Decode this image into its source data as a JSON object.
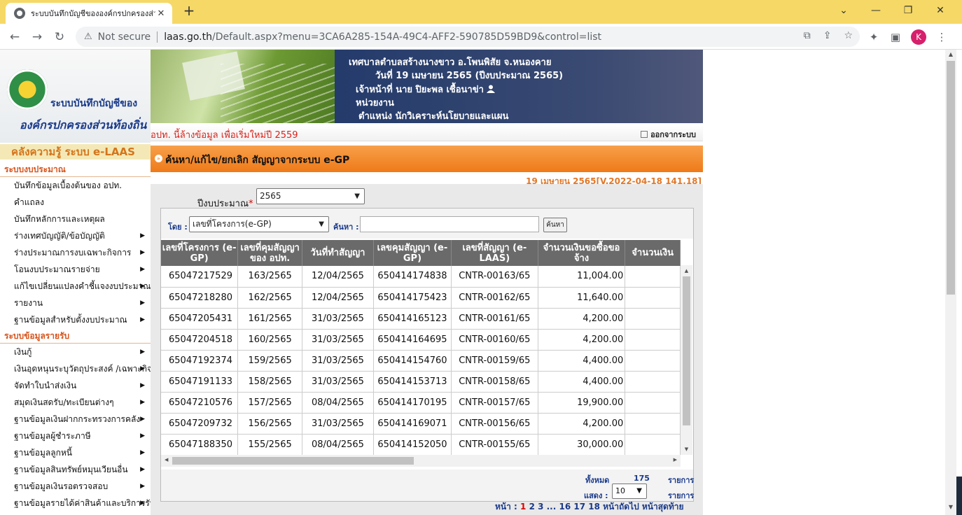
{
  "browser": {
    "tab_title": "ระบบบันทึกบัญชีขององค์กรปกครองส่วนท้องถิ่น",
    "address": {
      "not_secure": "Not secure",
      "host": "laas.go.th",
      "path": "/Default.aspx?menu=3CA6A285-154A-49C4-AFF2-590785D59BD9&control=list"
    },
    "profile_initial": "K"
  },
  "logo": {
    "line1": "ระบบบันทึกบัญชีของ",
    "line2": "องค์กรปกครองส่วนท้องถิ่น"
  },
  "knowledge_banner": "คลังความรู้ ระบบ e-LAAS",
  "menu": {
    "budget_section": "ระบบงบประมาณ",
    "budget_items": [
      {
        "label": "บันทึกข้อมูลเบื้องต้นของ อปท.",
        "sub": false
      },
      {
        "label": "คำแถลง",
        "sub": false
      },
      {
        "label": "บันทึกหลักการและเหตุผล",
        "sub": false
      },
      {
        "label": "ร่างเทศบัญญัติ/ข้อบัญญัติ",
        "sub": true
      },
      {
        "label": "ร่างประมาณการงบเฉพาะกิจการ",
        "sub": true
      },
      {
        "label": "โอนงบประมาณรายจ่าย",
        "sub": true
      },
      {
        "label": "แก้ไขเปลี่ยนแปลงคำชี้แจงงบประมาณ",
        "sub": true
      },
      {
        "label": "รายงาน",
        "sub": true
      },
      {
        "label": "ฐานข้อมูลสำหรับตั้งงบประมาณ",
        "sub": true
      }
    ],
    "revenue_section": "ระบบข้อมูลรายรับ",
    "revenue_items": [
      {
        "label": "เงินกู้",
        "sub": true
      },
      {
        "label": "เงินอุดหนุนระบุวัตถุประสงค์ /เฉพาะกิจ",
        "sub": true
      },
      {
        "label": "จัดทำใบนำส่งเงิน",
        "sub": true
      },
      {
        "label": "สมุดเงินสดรับ/ทะเบียนต่างๆ",
        "sub": true
      },
      {
        "label": "ฐานข้อมูลเงินฝากกระทรวงการคลัง",
        "sub": true
      },
      {
        "label": "ฐานข้อมูลผู้ชำระภาษี",
        "sub": true
      },
      {
        "label": "ฐานข้อมูลลูกหนี้",
        "sub": true
      },
      {
        "label": "ฐานข้อมูลสินทรัพย์หมุนเวียนอื่น",
        "sub": true
      },
      {
        "label": "ฐานข้อมูลเงินรอตรวจสอบ",
        "sub": true
      },
      {
        "label": "ฐานข้อมูลรายได้ค่าสินค้าและบริการรับ",
        "sub": true
      }
    ]
  },
  "header": {
    "org": "เทศบาลตำบลสร้างนางขาว อ.โพนพิสัย จ.หนองคาย",
    "date_line": "วันที่ 19 เมษายน 2565  (ปีงบประมาณ 2565)",
    "officer": "เจ้าหน้าที่ นาย ปิยะพล เชื้อนาข่า",
    "unit": "หน่วยงาน",
    "position": "ตำแหน่ง นักวิเคราะห์นโยบายและแผน",
    "notice": "อปท. นี้ล้างข้อมูล เพื่อเริ่มใหม่ปี 2559",
    "logout": "ออกจากระบบ"
  },
  "page": {
    "title": "ค้นหา/แก้ไข/ยกเลิก สัญญาจากระบบ e-GP",
    "version": "19 เมษายน 2565[V.2022-04-18 141.18]",
    "fiscal_year_label": "ปีงบประมาณ",
    "fiscal_year_value": "2565",
    "search": {
      "by_label": "โดย :",
      "by_value": "เลขที่โครงการ(e-GP)",
      "find_label": "ค้นหา :",
      "find_value": "",
      "button": "ค้นหา"
    }
  },
  "table": {
    "headers": [
      "เลขที่โครงการ (e-GP)",
      "เลขที่คุมสัญญา ของ อปท.",
      "วันที่ทำสัญญา",
      "เลขคุมสัญญา (e-GP)",
      "เลขที่สัญญา (e-LAAS)",
      "จำนวนเงินขอซื้อขอจ้าง",
      "จำนวนเงิน"
    ],
    "rows": [
      [
        "65047217529",
        "163/2565",
        "12/04/2565",
        "650414174838",
        "CNTR-00163/65",
        "11,004.00",
        ""
      ],
      [
        "65047218280",
        "162/2565",
        "12/04/2565",
        "650414175423",
        "CNTR-00162/65",
        "11,640.00",
        ""
      ],
      [
        "65047205431",
        "161/2565",
        "31/03/2565",
        "650414165123",
        "CNTR-00161/65",
        "4,200.00",
        ""
      ],
      [
        "65047204518",
        "160/2565",
        "31/03/2565",
        "650414164695",
        "CNTR-00160/65",
        "4,200.00",
        ""
      ],
      [
        "65047192374",
        "159/2565",
        "31/03/2565",
        "650414154760",
        "CNTR-00159/65",
        "4,400.00",
        ""
      ],
      [
        "65047191133",
        "158/2565",
        "31/03/2565",
        "650414153713",
        "CNTR-00158/65",
        "4,400.00",
        ""
      ],
      [
        "65047210576",
        "157/2565",
        "08/04/2565",
        "650414170195",
        "CNTR-00157/65",
        "19,900.00",
        ""
      ],
      [
        "65047209732",
        "156/2565",
        "31/03/2565",
        "650414169071",
        "CNTR-00156/65",
        "4,200.00",
        ""
      ],
      [
        "65047188350",
        "155/2565",
        "08/04/2565",
        "650414152050",
        "CNTR-00155/65",
        "30,000.00",
        ""
      ]
    ]
  },
  "footer": {
    "total_label": "ทั้งหมด",
    "total_value": "175",
    "total_unit": "รายการ",
    "show_label": "แสดง :",
    "show_value": "10",
    "show_unit": "รายการ"
  },
  "pager": {
    "label": "หน้า :",
    "current": "1",
    "pages": "2  3  ...  16  17  18",
    "next": "หน้าถัดไป",
    "last": "หน้าสุดท้าย"
  }
}
